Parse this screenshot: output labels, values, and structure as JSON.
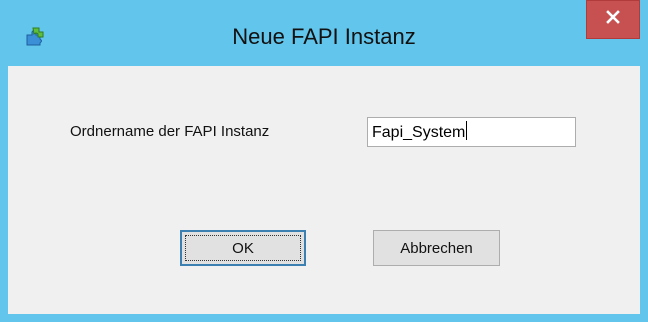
{
  "window": {
    "title": "Neue FAPI Instanz",
    "app_icon": "puzzle-app-icon",
    "close_icon": "close-icon",
    "titlebar_color": "#62c5ec",
    "close_color": "#c75050"
  },
  "form": {
    "folder_label": "Ordnername der FAPI Instanz",
    "folder_value": "Fapi_System"
  },
  "buttons": {
    "ok_label": "OK",
    "cancel_label": "Abbrechen"
  }
}
